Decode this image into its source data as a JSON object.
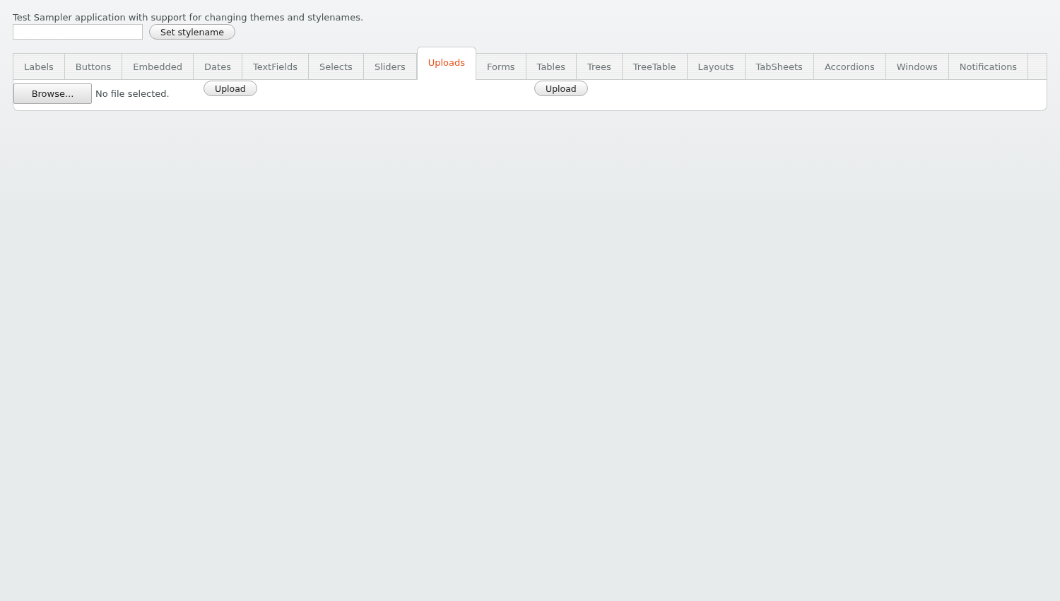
{
  "description": "Test Sampler application with support for changing themes and stylenames.",
  "set_button": "Set stylename",
  "tabs": [
    {
      "label": "Labels",
      "selected": false
    },
    {
      "label": "Buttons",
      "selected": false
    },
    {
      "label": "Embedded",
      "selected": false
    },
    {
      "label": "Dates",
      "selected": false
    },
    {
      "label": "TextFields",
      "selected": false
    },
    {
      "label": "Selects",
      "selected": false
    },
    {
      "label": "Sliders",
      "selected": false
    },
    {
      "label": "Uploads",
      "selected": true
    },
    {
      "label": "Forms",
      "selected": false
    },
    {
      "label": "Tables",
      "selected": false
    },
    {
      "label": "Trees",
      "selected": false
    },
    {
      "label": "TreeTable",
      "selected": false
    },
    {
      "label": "Layouts",
      "selected": false
    },
    {
      "label": "TabSheets",
      "selected": false
    },
    {
      "label": "Accordions",
      "selected": false
    },
    {
      "label": "Windows",
      "selected": false
    },
    {
      "label": "Notifications",
      "selected": false
    }
  ],
  "upload": {
    "browse_button": "Browse...",
    "file_status": "No file selected.",
    "upload_buttons": [
      "Upload",
      "Upload"
    ]
  }
}
